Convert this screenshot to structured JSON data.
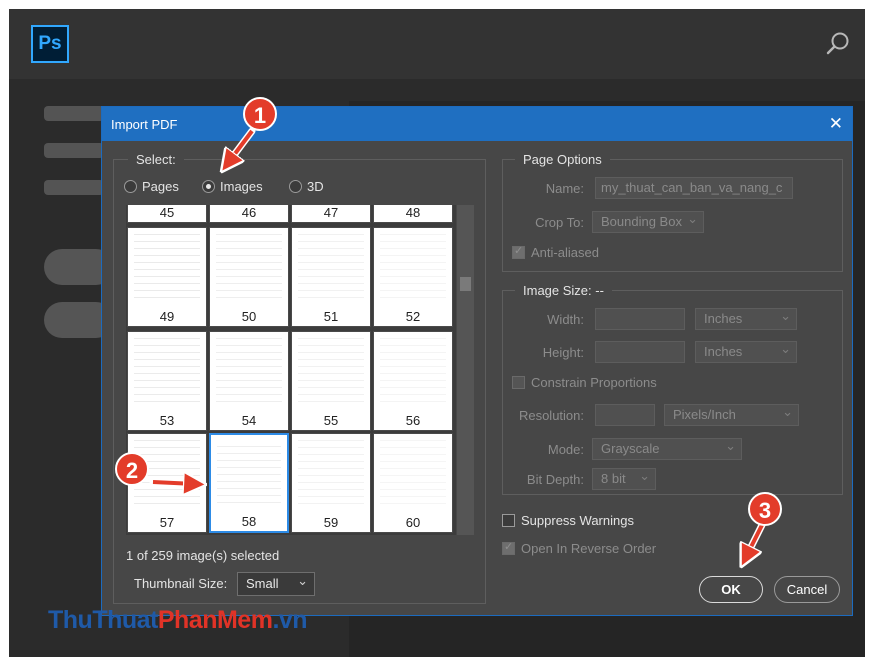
{
  "app": {
    "logo_text": "Ps"
  },
  "dialog": {
    "title": "Import PDF",
    "select": {
      "legend": "Select:",
      "radios": [
        {
          "label": "Pages",
          "checked": false
        },
        {
          "label": "Images",
          "checked": true
        },
        {
          "label": "3D",
          "checked": false
        }
      ],
      "thumbnails": [
        {
          "num": "45"
        },
        {
          "num": "46"
        },
        {
          "num": "47"
        },
        {
          "num": "48"
        },
        {
          "num": "49"
        },
        {
          "num": "50"
        },
        {
          "num": "51"
        },
        {
          "num": "52"
        },
        {
          "num": "53"
        },
        {
          "num": "54"
        },
        {
          "num": "55"
        },
        {
          "num": "56"
        },
        {
          "num": "57"
        },
        {
          "num": "58",
          "selected": true
        },
        {
          "num": "59"
        },
        {
          "num": "60"
        }
      ],
      "selection_status": "1 of 259 image(s) selected",
      "thumbnail_size_label": "Thumbnail Size:",
      "thumbnail_size_value": "Small"
    },
    "page_options": {
      "legend": "Page Options",
      "name_label": "Name:",
      "name_value": "my_thuat_can_ban_va_nang_c",
      "crop_label": "Crop To:",
      "crop_value": "Bounding Box",
      "anti_aliased_label": "Anti-aliased"
    },
    "image_size": {
      "legend": "Image Size: --",
      "width_label": "Width:",
      "width_unit": "Inches",
      "height_label": "Height:",
      "height_unit": "Inches",
      "constrain_label": "Constrain Proportions",
      "resolution_label": "Resolution:",
      "resolution_unit": "Pixels/Inch",
      "mode_label": "Mode:",
      "mode_value": "Grayscale",
      "bit_depth_label": "Bit Depth:",
      "bit_depth_value": "8 bit"
    },
    "suppress_warnings_label": "Suppress Warnings",
    "reverse_order_label": "Open In Reverse Order",
    "ok_label": "OK",
    "cancel_label": "Cancel"
  },
  "annotations": {
    "step1": "1",
    "step2": "2",
    "step3": "3"
  },
  "watermark": {
    "part1": "ThuThuat",
    "part2": "PhanMem",
    "part3": ".vn"
  },
  "colors": {
    "accent": "#1f6fc1",
    "badge": "#e33c2a",
    "ps_blue": "#31a8ff"
  }
}
